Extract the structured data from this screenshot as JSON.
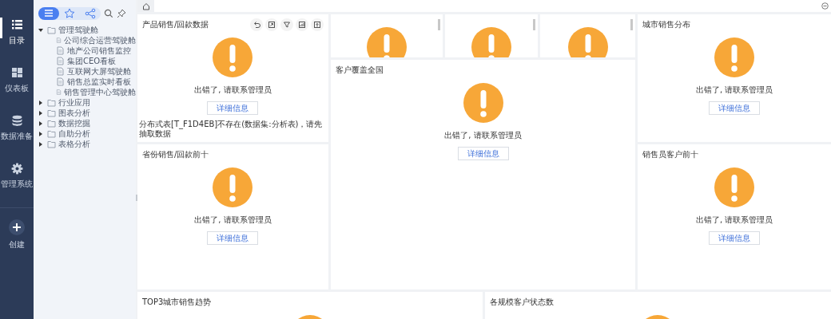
{
  "sidebar": {
    "items": [
      {
        "kind": "catalog",
        "label": "目录",
        "selected": true
      },
      {
        "kind": "dashboard",
        "label": "仪表板",
        "selected": false
      },
      {
        "kind": "data",
        "label": "数据准备",
        "selected": false
      },
      {
        "kind": "admin",
        "label": "管理系统",
        "selected": false
      }
    ],
    "create": {
      "label": "创建"
    }
  },
  "tree_panel": {
    "tabs": [
      {
        "kind": "list",
        "selected": true
      },
      {
        "kind": "favorites",
        "selected": false
      },
      {
        "kind": "share",
        "selected": false
      }
    ]
  },
  "tree": [
    {
      "kind": "folder",
      "label": "管理驾驶舱",
      "expanded": true,
      "children": [
        {
          "kind": "file",
          "label": "公司综合运营驾驶舱"
        },
        {
          "kind": "file",
          "label": "地产公司销售监控"
        },
        {
          "kind": "file",
          "label": "集团CEO看板"
        },
        {
          "kind": "file",
          "label": "互联网大屏驾驶舱"
        },
        {
          "kind": "file",
          "label": "销售总监实时看板"
        },
        {
          "kind": "file",
          "label": "销售管理中心驾驶舱"
        }
      ]
    },
    {
      "kind": "folder",
      "label": "行业应用",
      "expanded": false
    },
    {
      "kind": "folder",
      "label": "图表分析",
      "expanded": false
    },
    {
      "kind": "folder",
      "label": "数据挖掘",
      "expanded": false
    },
    {
      "kind": "folder",
      "label": "自助分析",
      "expanded": false
    },
    {
      "kind": "folder",
      "label": "表格分析",
      "expanded": false
    }
  ],
  "cards": [
    {
      "kind": "error",
      "title": "产品销售/回款数据",
      "toolbar": true,
      "message": "出错了, 请联系管理员",
      "button": "详细信息",
      "detail": "分布式表[T_F1D4EB]不存在(数据集:分析表)，请先抽取数据"
    },
    {
      "kind": "clipped"
    },
    {
      "kind": "clipped"
    },
    {
      "kind": "clipped"
    },
    {
      "kind": "error",
      "title": "客户覆盖全国",
      "message": "出错了, 请联系管理员",
      "button": "详细信息"
    },
    {
      "kind": "error",
      "title": "城市销售分布",
      "message": "出错了, 请联系管理员",
      "button": "详细信息"
    },
    {
      "kind": "error",
      "title": "省份销售/回款前十",
      "message": "出错了, 请联系管理员",
      "button": "详细信息"
    },
    {
      "kind": "error",
      "title": "销售员客户前十",
      "message": "出错了, 请联系管理员",
      "button": "详细信息"
    },
    {
      "kind": "clipped",
      "title": "TOP3城市销售趋势"
    },
    {
      "kind": "clipped",
      "title": "各规模客户状态数"
    }
  ]
}
